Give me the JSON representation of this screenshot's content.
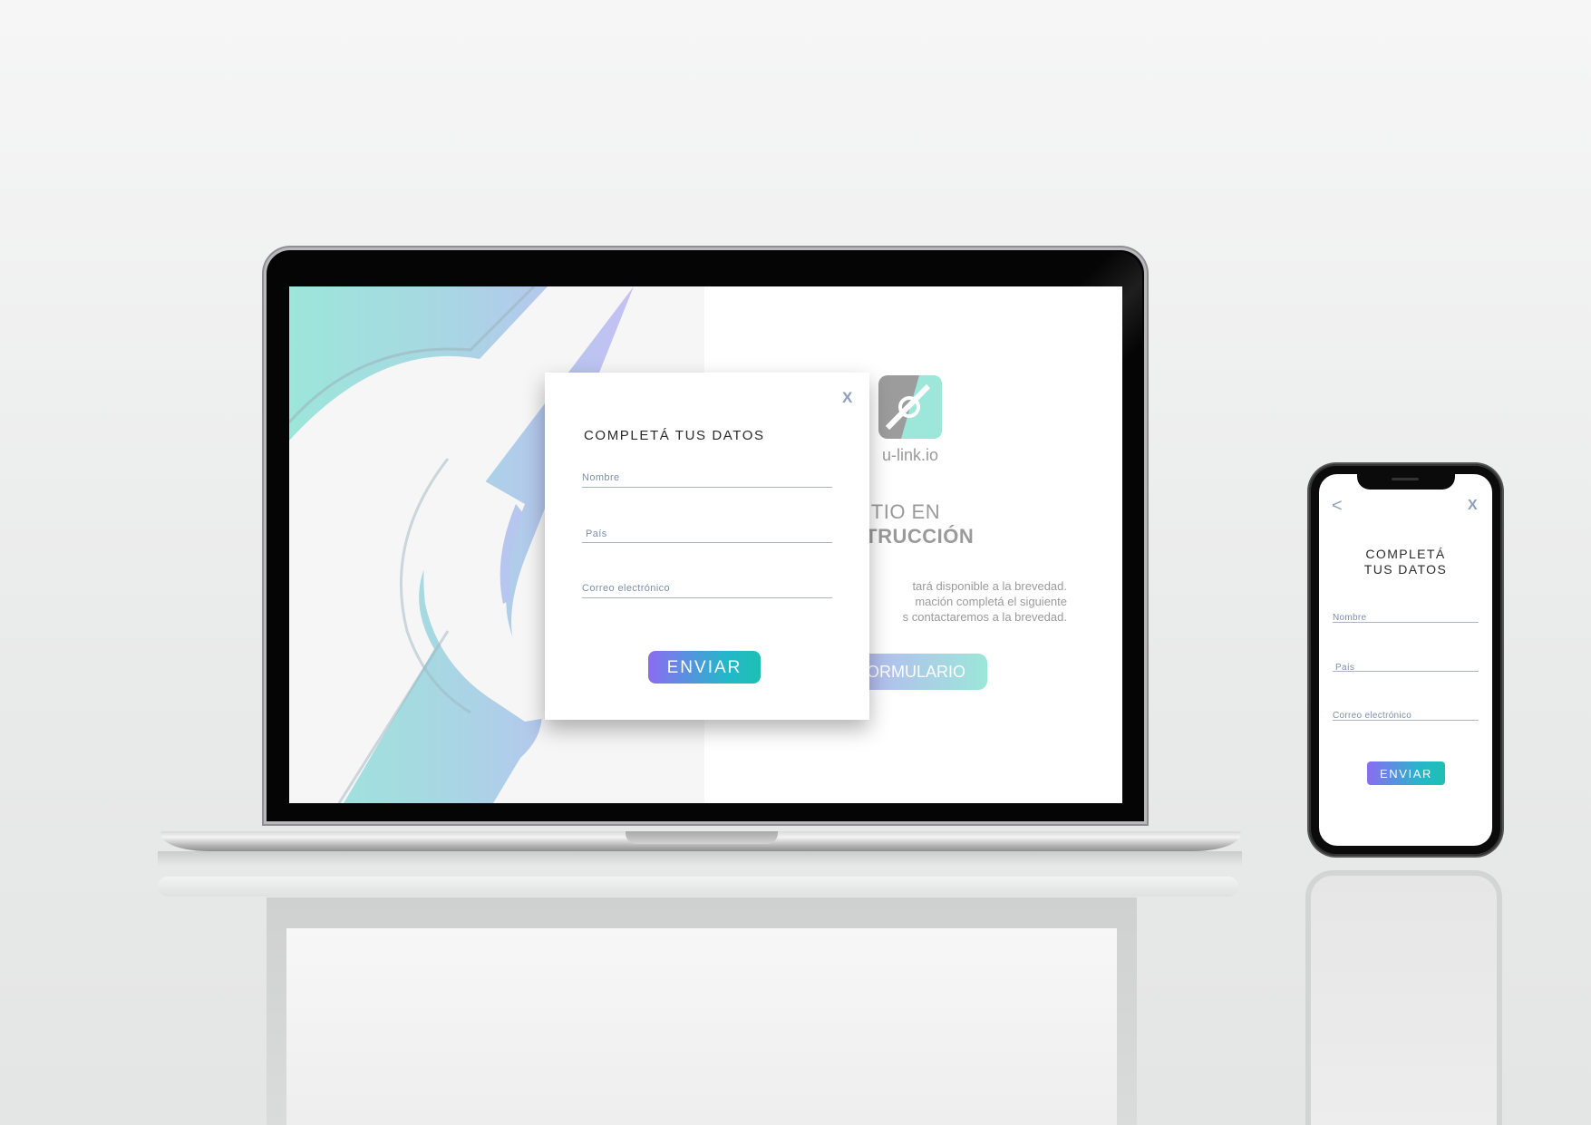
{
  "laptop": {
    "logo_text": "u-link.io",
    "headline_line1": "SITIO EN",
    "headline_line2": "STRUCCIÓN",
    "paragraph_line1": "tará disponible a la brevedad.",
    "paragraph_line2": "mación completá el siguiente",
    "paragraph_line3": "s contactaremos a la brevedad.",
    "form_button": "ORMULARIO",
    "modal": {
      "close": "X",
      "title": "COMPLETÁ TUS DATOS",
      "name_placeholder": "Nombre",
      "country_placeholder": "País",
      "email_placeholder": "Correo electrónico",
      "submit": "ENVIAR"
    }
  },
  "phone": {
    "back": "<",
    "close": "X",
    "title_line1": "COMPLETÁ",
    "title_line2": "TUS DATOS",
    "name_placeholder": "Nombre",
    "country_placeholder": "País",
    "email_placeholder": "Correo electrónico",
    "submit": "ENVIAR"
  },
  "colors": {
    "mint": "#9ce6da",
    "lavender": "#d3bcf8",
    "button_start": "#8b6cf3",
    "button_end": "#1fbfb3",
    "placeholder": "#7d8fa8"
  }
}
